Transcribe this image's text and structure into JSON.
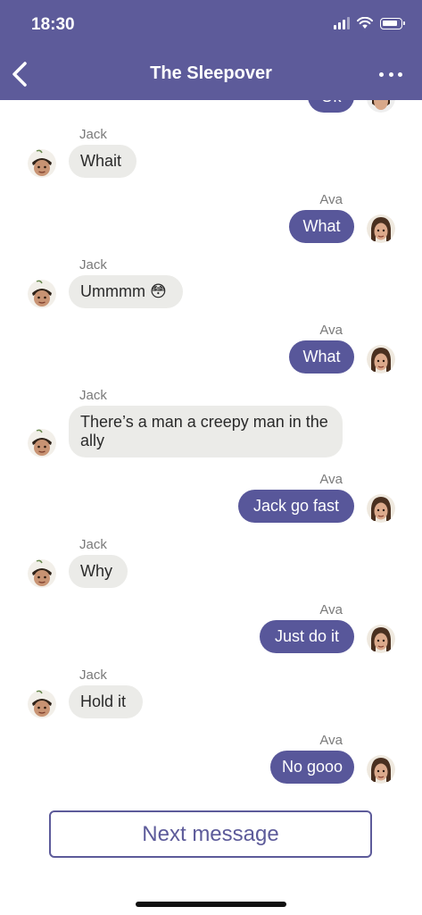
{
  "status_bar": {
    "time": "18:30"
  },
  "header": {
    "title": "The Sleepover"
  },
  "partial_top_message": {
    "text": "Ok"
  },
  "messages": [
    {
      "sender": "Jack",
      "text": "Whait",
      "direction": "in"
    },
    {
      "sender": "Ava",
      "text": "What",
      "direction": "out"
    },
    {
      "sender": "Jack",
      "text": "Ummmm 😳",
      "direction": "in"
    },
    {
      "sender": "Ava",
      "text": "What",
      "direction": "out"
    },
    {
      "sender": "Jack",
      "text": "There’s a man a creepy man in the ally",
      "direction": "in"
    },
    {
      "sender": "Ava",
      "text": "Jack go fast",
      "direction": "out"
    },
    {
      "sender": "Jack",
      "text": "Why",
      "direction": "in"
    },
    {
      "sender": "Ava",
      "text": "Just do it",
      "direction": "out"
    },
    {
      "sender": "Jack",
      "text": "Hold it",
      "direction": "in"
    },
    {
      "sender": "Ava",
      "text": "No gooo",
      "direction": "out"
    }
  ],
  "next_button": {
    "label": "Next message"
  },
  "colors": {
    "header": "#5d5b9a",
    "outgoing_bubble": "#58579a",
    "incoming_bubble": "#ebebe8"
  }
}
